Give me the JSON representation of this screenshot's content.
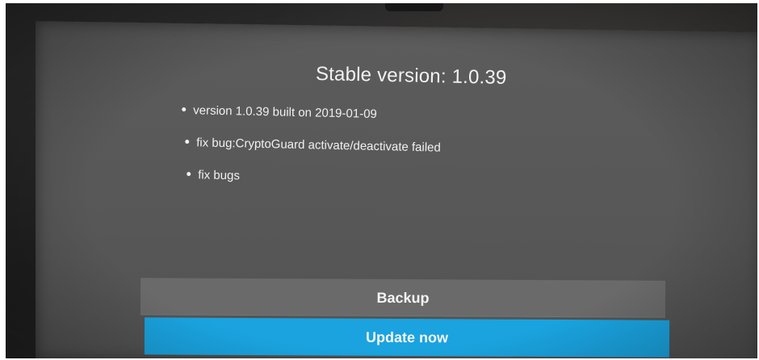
{
  "dialog": {
    "title": "Stable version: 1.0.39",
    "release_notes": [
      "version 1.0.39 built on 2019-01-09",
      "fix bug:CryptoGuard activate/deactivate failed",
      "fix bugs"
    ]
  },
  "actions": {
    "backup_label": "Backup",
    "update_label": "Update now"
  },
  "colors": {
    "dialog_bg": "#595959",
    "backup_bg": "#6a6a6a",
    "update_accent": "#1aa3df",
    "text": "#f2f2f2"
  }
}
